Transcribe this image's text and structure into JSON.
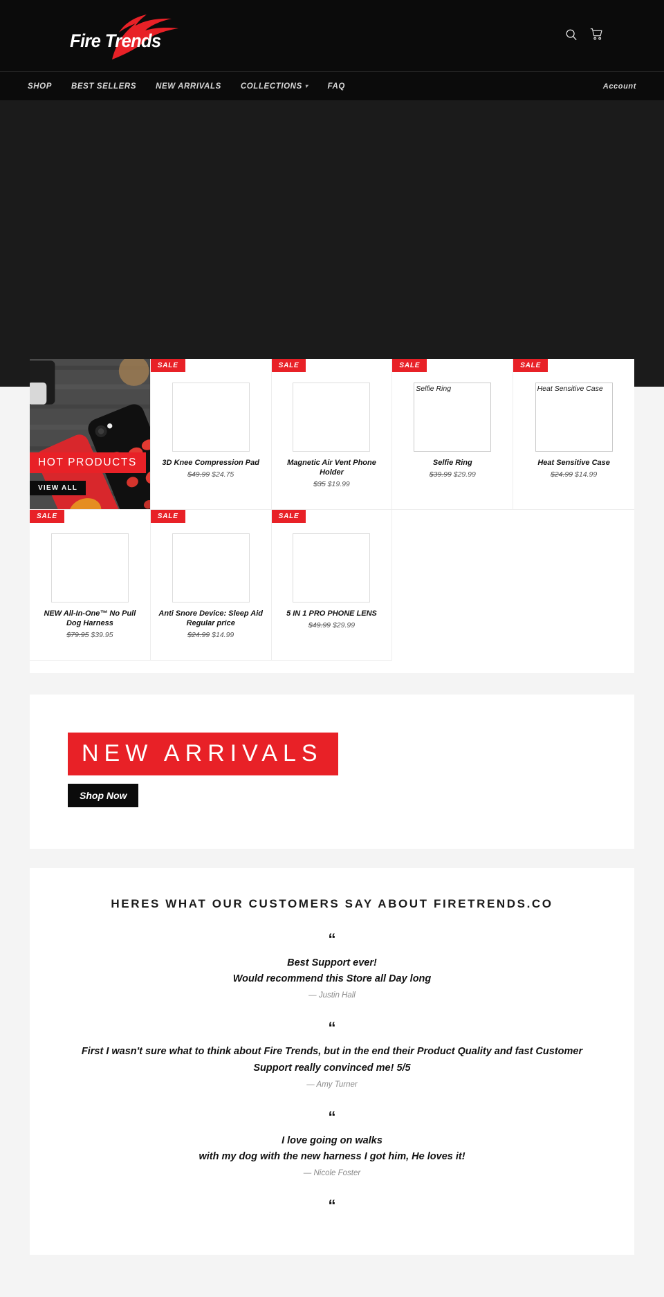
{
  "brand": {
    "name": "Fire Trends",
    "accent": "#e82127",
    "dark": "#0b0b0b"
  },
  "header": {
    "search_icon": "search-icon",
    "cart_icon": "cart-icon"
  },
  "nav": {
    "items": [
      {
        "label": "SHOP",
        "has_caret": false
      },
      {
        "label": "BEST SELLERS",
        "has_caret": false
      },
      {
        "label": "NEW ARRIVALS",
        "has_caret": false
      },
      {
        "label": "COLLECTIONS",
        "has_caret": true
      },
      {
        "label": "FAQ",
        "has_caret": false
      }
    ],
    "account_label": "Account"
  },
  "promo_tile": {
    "label": "HOT PRODUCTS",
    "button": "VIEW ALL"
  },
  "products": [
    {
      "badge": "SALE",
      "name": "3D Knee Compression Pad",
      "price_was": "$49.99",
      "price_now": "$24.75",
      "alt_text": ""
    },
    {
      "badge": "SALE",
      "name": "Magnetic Air Vent Phone Holder",
      "price_was": "$35",
      "price_now": "$19.99",
      "alt_text": ""
    },
    {
      "badge": "SALE",
      "name": "Selfie Ring",
      "price_was": "$39.99",
      "price_now": "$29.99",
      "alt_text": "Selfie Ring"
    },
    {
      "badge": "SALE",
      "name": "Heat Sensitive Case",
      "price_was": "$24.99",
      "price_now": "$14.99",
      "alt_text": "Heat Sensitive Case"
    },
    {
      "badge": "SALE",
      "name": "NEW All-In-One™  No Pull Dog Harness",
      "price_was": "$79.95",
      "price_now": "$39.95",
      "alt_text": ""
    },
    {
      "badge": "SALE",
      "name": "Anti Snore Device: Sleep Aid Regular price",
      "price_was": "$24.99",
      "price_now": "$14.99",
      "alt_text": ""
    },
    {
      "badge": "SALE",
      "name": "5 IN 1 PRO PHONE LENS",
      "price_was": "$49.99",
      "price_now": "$29.99",
      "alt_text": ""
    }
  ],
  "arrivals": {
    "title": "NEW ARRIVALS",
    "button": "Shop Now"
  },
  "testimonials": {
    "heading": "HERES WHAT OUR CUSTOMERS SAY ABOUT FIRETRENDS.CO",
    "quote_glyph": "“",
    "items": [
      {
        "lines": [
          "Best Support ever!",
          "Would recommend this Store all Day long"
        ],
        "author": "— Justin Hall"
      },
      {
        "lines": [
          "First I wasn't sure what to think about Fire Trends, but in the end their Product Quality and fast Customer Support really convinced me! 5/5"
        ],
        "author": "— Amy Turner"
      },
      {
        "lines": [
          "I love going on walks",
          "with my dog with the new harness I got him, He loves it!"
        ],
        "author": "— Nicole Foster"
      },
      {
        "lines": [],
        "author": ""
      }
    ]
  }
}
